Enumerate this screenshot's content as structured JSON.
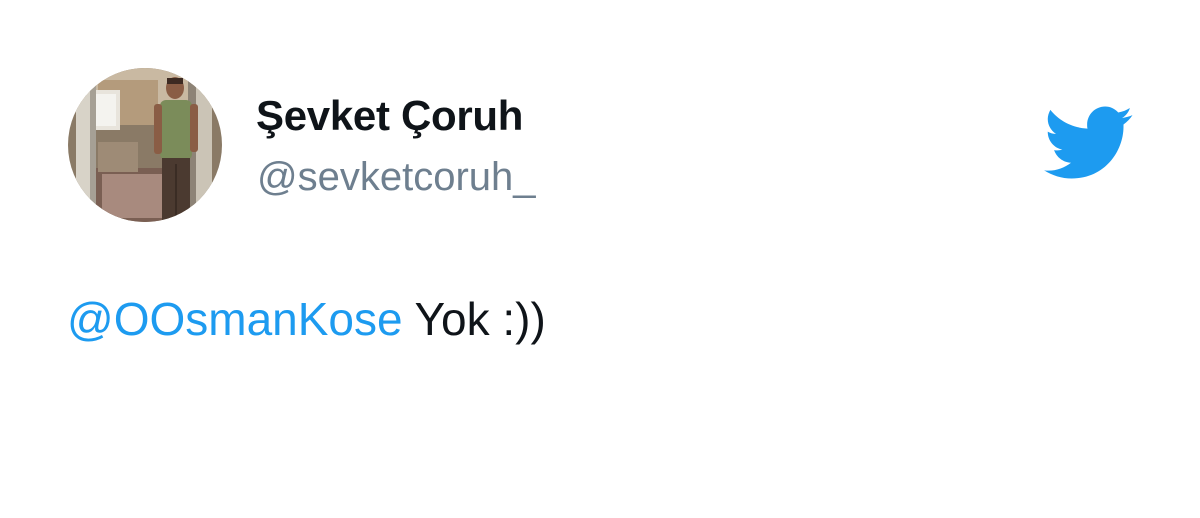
{
  "author": {
    "display_name": "Şevket Çoruh",
    "handle": "@sevketcoruh_",
    "avatar_icon": "profile-photo"
  },
  "tweet": {
    "mention": "@OOsmanKose",
    "text": " Yok :))"
  },
  "brand": {
    "logo_icon": "twitter-bird-icon",
    "accent_color": "#1d9bf0",
    "text_color": "#0f1419",
    "muted_color": "#6e7f8f"
  }
}
